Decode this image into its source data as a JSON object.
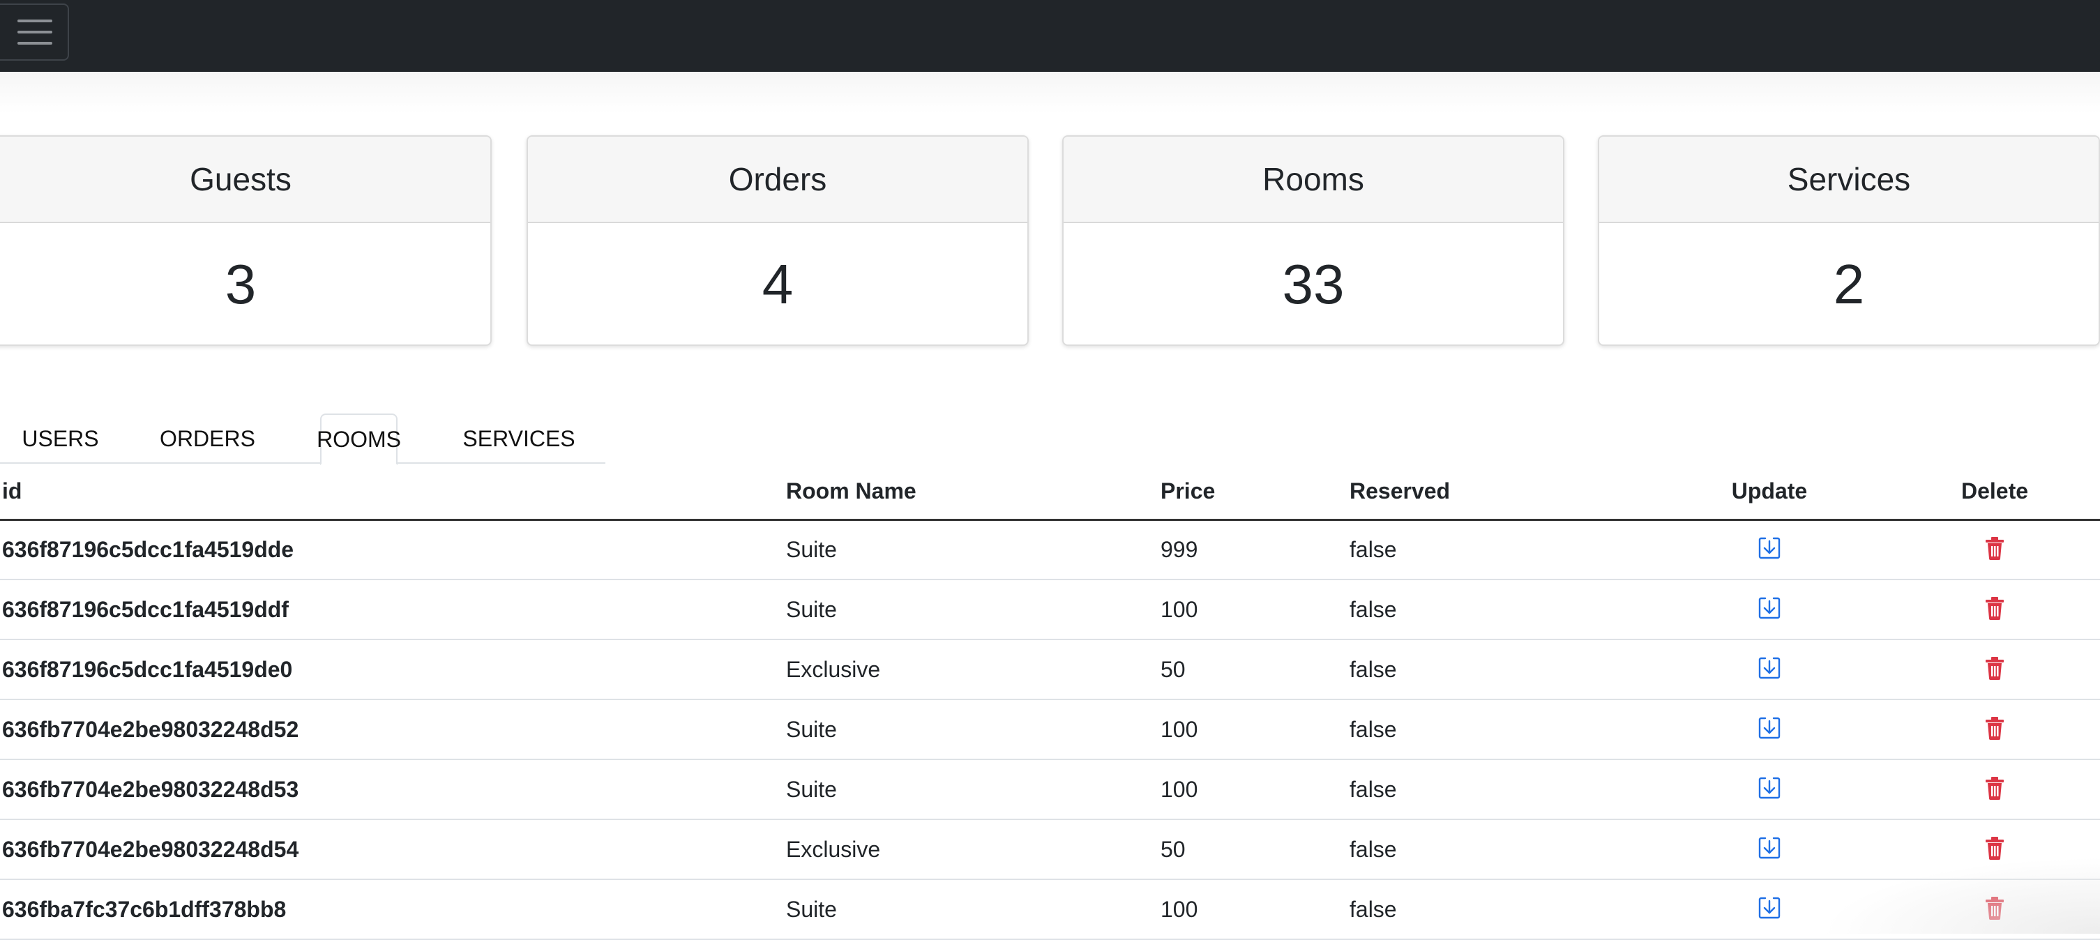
{
  "navbar": {
    "toggle_icon": "hamburger-menu-icon"
  },
  "stats": [
    {
      "title": "Guests",
      "value": "3"
    },
    {
      "title": "Orders",
      "value": "4"
    },
    {
      "title": "Rooms",
      "value": "33"
    },
    {
      "title": "Services",
      "value": "2"
    }
  ],
  "tabs": [
    {
      "label": "USERS",
      "active": false
    },
    {
      "label": "ORDERS",
      "active": false
    },
    {
      "label": "ROOMS",
      "active": true
    },
    {
      "label": "SERVICES",
      "active": false
    }
  ],
  "table": {
    "headers": [
      "id",
      "Room Name",
      "Price",
      "Reserved",
      "Update",
      "Delete"
    ],
    "rows": [
      {
        "id": "636f87196c5dcc1fa4519dde",
        "name": "Suite",
        "price": "999",
        "reserved": "false"
      },
      {
        "id": "636f87196c5dcc1fa4519ddf",
        "name": "Suite",
        "price": "100",
        "reserved": "false"
      },
      {
        "id": "636f87196c5dcc1fa4519de0",
        "name": "Exclusive",
        "price": "50",
        "reserved": "false"
      },
      {
        "id": "636fb7704e2be98032248d52",
        "name": "Suite",
        "price": "100",
        "reserved": "false"
      },
      {
        "id": "636fb7704e2be98032248d53",
        "name": "Suite",
        "price": "100",
        "reserved": "false"
      },
      {
        "id": "636fb7704e2be98032248d54",
        "name": "Exclusive",
        "price": "50",
        "reserved": "false"
      },
      {
        "id": "636fba7fc37c6b1dff378bb8",
        "name": "Suite",
        "price": "100",
        "reserved": "false"
      }
    ],
    "update_icon": "download-icon",
    "delete_icon": "trash-icon"
  },
  "colors": {
    "navbar": "#212529",
    "update_icon": "#1f6fe5",
    "delete_icon": "#dc3545"
  }
}
